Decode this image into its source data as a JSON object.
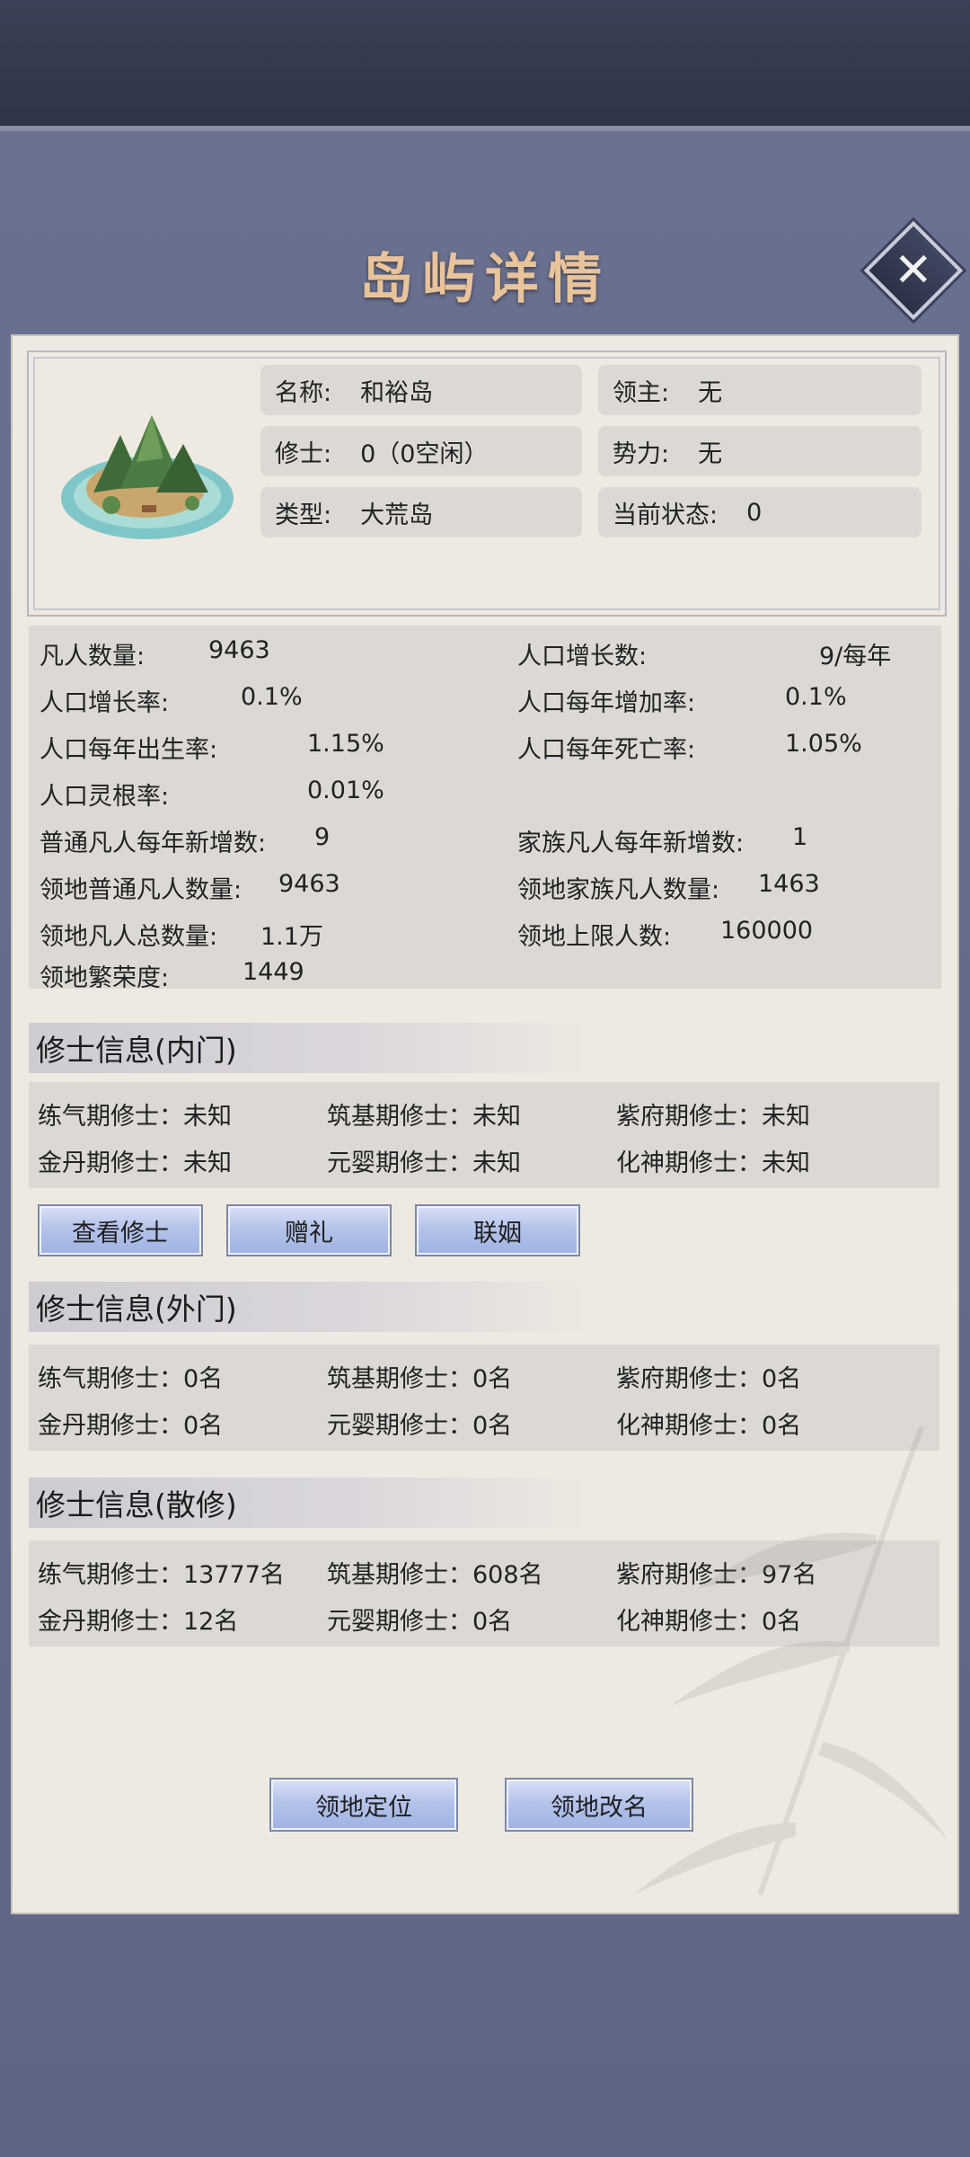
{
  "title": "岛屿详情",
  "close_icon": "close-icon",
  "island_icon": "island-icon",
  "info": {
    "name_label": "名称:",
    "name_value": "和裕岛",
    "lord_label": "领主:",
    "lord_value": "无",
    "cultivator_label": "修士:",
    "cultivator_value": "0（0空闲）",
    "power_label": "势力:",
    "power_value": "无",
    "type_label": "类型:",
    "type_value": "大荒岛",
    "status_label": "当前状态:",
    "status_value": "0"
  },
  "stats": {
    "mortal_count_label": "凡人数量:",
    "mortal_count_value": "9463",
    "growth_num_label": "人口增长数:",
    "growth_num_value": "9/每年",
    "growth_rate_label": "人口增长率:",
    "growth_rate_value": "0.1%",
    "increase_rate_label": "人口每年增加率:",
    "increase_rate_value": "0.1%",
    "birth_rate_label": "人口每年出生率:",
    "birth_rate_value": "1.15%",
    "death_rate_label": "人口每年死亡率:",
    "death_rate_value": "1.05%",
    "root_rate_label": "人口灵根率:",
    "root_rate_value": "0.01%",
    "normal_new_label": "普通凡人每年新增数:",
    "normal_new_value": "9",
    "family_new_label": "家族凡人每年新增数:",
    "family_new_value": "1",
    "normal_count_label": "领地普通凡人数量:",
    "normal_count_value": "9463",
    "family_count_label": "领地家族凡人数量:",
    "family_count_value": "1463",
    "total_label": "领地凡人总数量:",
    "total_value": "1.1万",
    "limit_label": "领地上限人数:",
    "limit_value": "160000",
    "prosperity_label": "领地繁荣度:",
    "prosperity_value": "1449"
  },
  "inner": {
    "header": "修士信息(内门)",
    "r1": [
      "练气期修士：未知",
      "筑基期修士：未知",
      "紫府期修士：未知"
    ],
    "r2": [
      "金丹期修士：未知",
      "元婴期修士：未知",
      "化神期修士：未知"
    ],
    "buttons": [
      "查看修士",
      "赠礼",
      "联姻"
    ]
  },
  "outer": {
    "header": "修士信息(外门)",
    "r1": [
      "练气期修士：0名",
      "筑基期修士：0名",
      "紫府期修士：0名"
    ],
    "r2": [
      "金丹期修士：0名",
      "元婴期修士：0名",
      "化神期修士：0名"
    ]
  },
  "loose": {
    "header": "修士信息(散修)",
    "r1": [
      "练气期修士：13777名",
      "筑基期修士：608名",
      "紫府期修士：97名"
    ],
    "r2": [
      "金丹期修士：12名",
      "元婴期修士：0名",
      "化神期修士：0名"
    ]
  },
  "footer": {
    "locate_label": "领地定位",
    "rename_label": "领地改名"
  },
  "colors": {
    "background": "#5f6784",
    "card": "#efeae1",
    "title": "#e9c39a",
    "button": "#b4c3ea"
  }
}
